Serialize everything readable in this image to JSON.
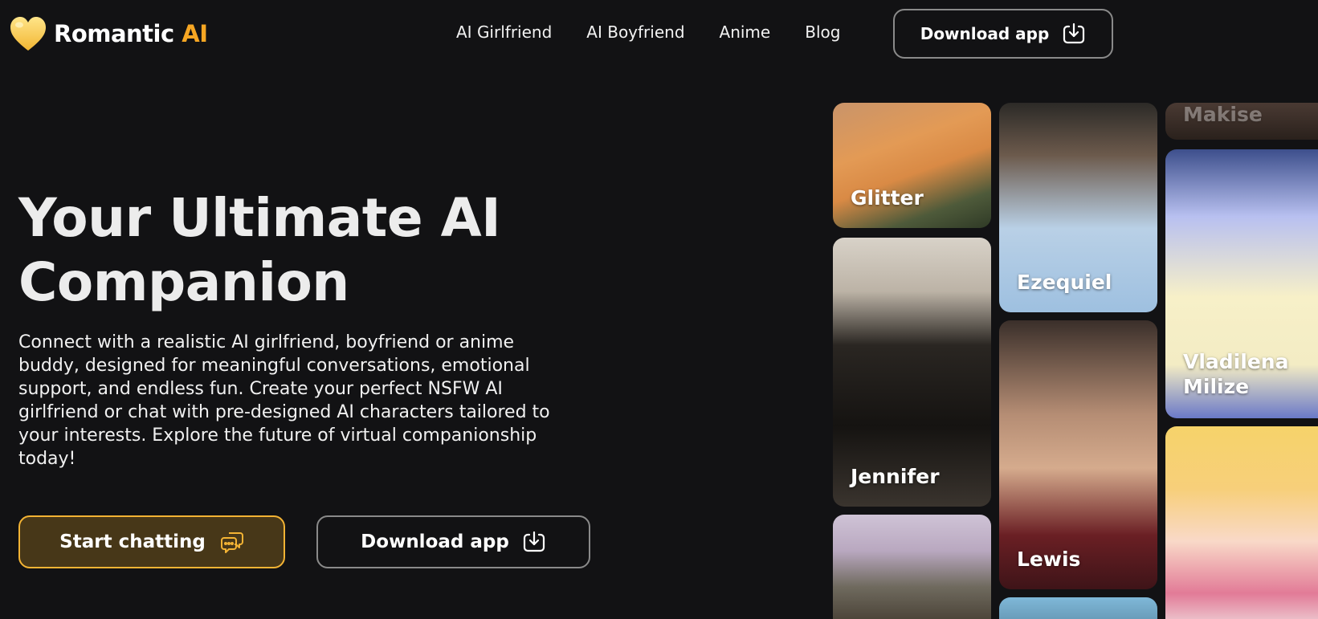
{
  "header": {
    "logo_primary": "Romantic",
    "logo_accent": "AI",
    "nav": [
      "AI Girlfriend",
      "AI Boyfriend",
      "Anime",
      "Blog"
    ],
    "download_label": "Download app"
  },
  "hero": {
    "title_line1": "Your Ultimate AI",
    "title_line2": "Companion",
    "description": "Connect with a realistic AI girlfriend, boyfriend or anime buddy, designed for meaningful conversations, emotional support, and endless fun. Create your perfect NSFW AI girlfriend or chat with pre-designed AI characters tailored to your interests. Explore the future of virtual companionship today!",
    "start_label": "Start chatting",
    "download_label": "Download app"
  },
  "cards": {
    "glitter": "Glitter",
    "jennifer": "Jennifer",
    "ezequiel": "Ezequiel",
    "lewis": "Lewis",
    "makise": "Makise",
    "vladilena_line1": "Vladilena",
    "vladilena_line2": "Milize"
  },
  "colors": {
    "background": "#121214",
    "accent": "#f6a623",
    "start_button_bg": "#473718",
    "start_button_border": "#f3b334"
  },
  "icons": {
    "logo": "heart-icon",
    "download": "download-icon",
    "chat": "chat-bubbles-icon"
  }
}
